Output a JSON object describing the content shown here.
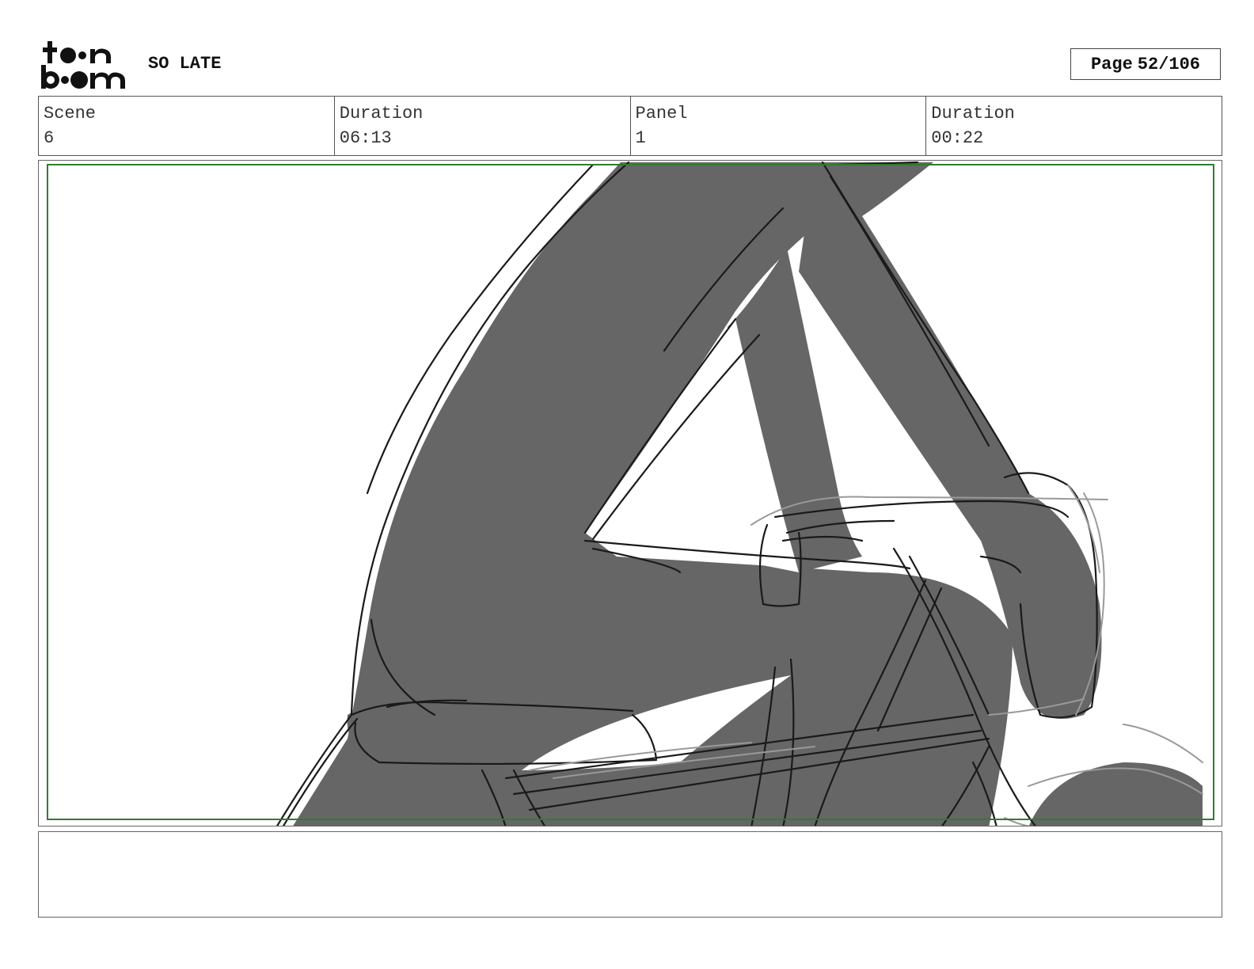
{
  "header": {
    "logo_text": "toon boom",
    "project_title": "SO LATE",
    "page_label": "Page",
    "page_value": "52/106"
  },
  "info": {
    "scene_label": "Scene",
    "scene_value": "6",
    "scene_duration_label": "Duration",
    "scene_duration_value": "06:13",
    "panel_label": "Panel",
    "panel_value": "1",
    "panel_duration_label": "Duration",
    "panel_duration_value": "00:22"
  },
  "panel": {
    "drawing": "sketch-character-on-bicycle",
    "safe_frame_color": "#2e7d32",
    "fill_color": "#666666",
    "line_color": "#1a1a1a"
  },
  "notes": {
    "text": ""
  }
}
